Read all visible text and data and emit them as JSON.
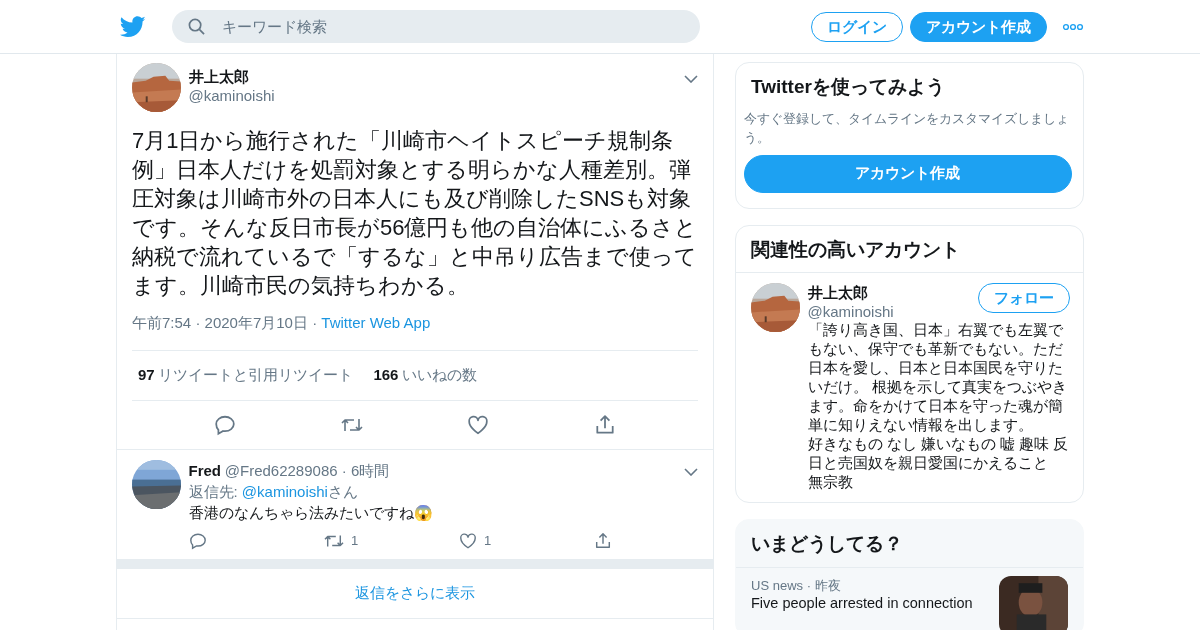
{
  "header": {
    "search": {
      "placeholder": "キーワード検索"
    },
    "buttons": [
      {
        "label": "ログイン",
        "kind": "outline"
      },
      {
        "label": "アカウント作成",
        "kind": "filled"
      }
    ]
  },
  "tweet": {
    "name": "井上太郎",
    "handle": "@kaminoishi",
    "text": "7月1日から施行された「川崎市ヘイトスピーチ規制条例」日本人だけを処罰対象とする明らかな人種差別。弾圧対象は川崎市外の日本人にも及び削除したSNSも対象です。そんな反日市長が56億円も他の自治体にふるさと納税で流れているで「するな」と中吊り広告まで使ってます。川崎市民の気持ちわかる。",
    "separator": "·",
    "time": "午前7:54",
    "date": "2020年7月10日",
    "source": "Twitter Web App",
    "stats": [
      {
        "count": "97",
        "label": "リツイートと引用リツイート"
      },
      {
        "count": "166",
        "label": "いいねの数"
      }
    ]
  },
  "replies": [
    {
      "name": "Fred",
      "handle": "@Fred62289086",
      "separator": "·",
      "time": "6時間",
      "reply_prefix": "返信先: ",
      "reply_to": "@kaminoishi",
      "reply_suffix": "さん",
      "text": "香港のなんちゃら法みたいですね😱",
      "retweets": "1",
      "likes": "1"
    }
  ],
  "show_more": "返信をさらに表示",
  "signup_card": {
    "title": "Twitterを使ってみよう",
    "subtitle": "今すぐ登録して、タイムラインをカスタマイズしましょう。",
    "button": "アカウント作成"
  },
  "related": {
    "title": "関連性の高いアカウント",
    "accounts": [
      {
        "name": "井上太郎",
        "handle": "@kaminoishi",
        "follow": "フォロー",
        "bio": [
          "「誇り高き国、日本」右翼でも左翼でもない、保守でも革新でもない。ただ日本を愛し、日本と日本国民を守りたいだけ。 根拠を示して真実をつぶやきます。命をかけて日本を守った魂が簡単に知りえない情報を出します。",
          "好きなもの なし 嫌いなもの 嘘 趣味 反日と売国奴を親日愛国にかえること",
          "無宗教"
        ]
      }
    ]
  },
  "trends": {
    "title": "いまどうしてる？",
    "items": [
      {
        "category": "US news",
        "separator": "·",
        "time": "昨夜",
        "text": "Five people arrested in connection"
      }
    ]
  }
}
